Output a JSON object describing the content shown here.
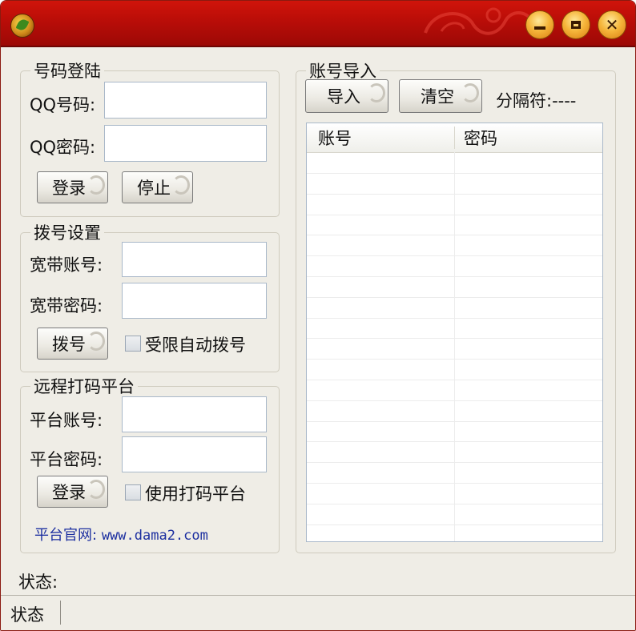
{
  "window": {
    "minimize_label": "minimize",
    "maximize_label": "maximize",
    "close_label": "close"
  },
  "qq_login": {
    "legend": "号码登陆",
    "qq_number_label": "QQ号码:",
    "qq_number_value": "",
    "qq_password_label": "QQ密码:",
    "qq_password_value": "",
    "login_button": "登录",
    "stop_button": "停止"
  },
  "dial": {
    "legend": "拨号设置",
    "broadband_account_label": "宽带账号:",
    "broadband_account_value": "",
    "broadband_password_label": "宽带密码:",
    "broadband_password_value": "",
    "dial_button": "拨号",
    "auto_dial_checkbox": "受限自动拨号",
    "auto_dial_checked": false
  },
  "captcha": {
    "legend": "远程打码平台",
    "platform_account_label": "平台账号:",
    "platform_account_value": "",
    "platform_password_label": "平台密码:",
    "platform_password_value": "",
    "login_button": "登录",
    "use_platform_checkbox": "使用打码平台",
    "use_platform_checked": false,
    "website_label": "平台官网:",
    "website_url": "www.dama2.com"
  },
  "import": {
    "legend": "账号导入",
    "import_button": "导入",
    "clear_button": "清空",
    "separator_label": "分隔符:----",
    "columns": [
      "账号",
      "密码"
    ],
    "rows": []
  },
  "status": {
    "label": "状态:",
    "statusbar_panel": "状态"
  }
}
